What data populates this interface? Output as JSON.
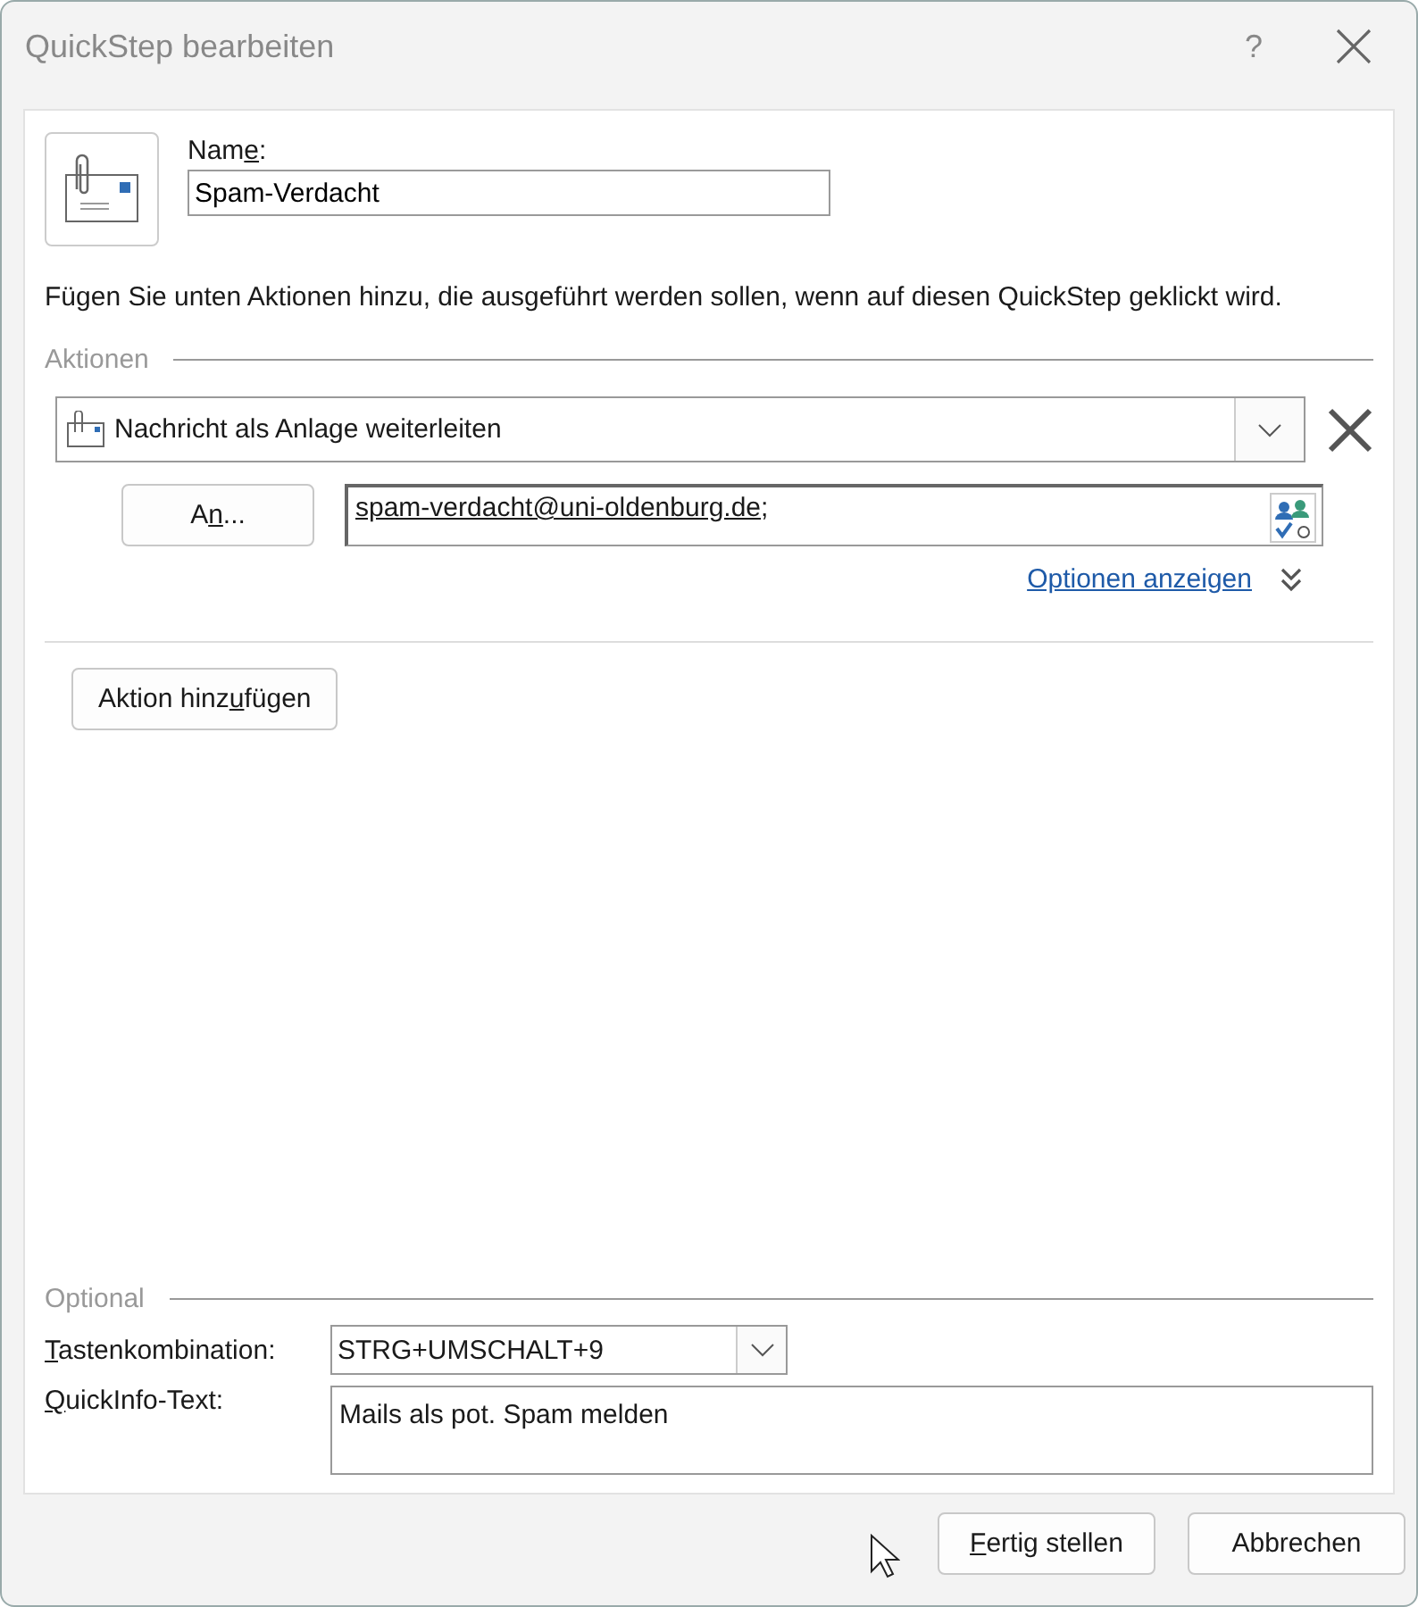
{
  "window": {
    "title": "QuickStep bearbeiten",
    "help": "?"
  },
  "name": {
    "label": {
      "before": "Nam",
      "key": "e",
      "after": ":"
    },
    "value": "Spam-Verdacht"
  },
  "description": "Fügen Sie unten Aktionen hinzu, die ausgeführt werden sollen, wenn auf diesen QuickStep geklickt wird.",
  "actions_section": {
    "title": "Aktionen",
    "actions": [
      {
        "kind": "forward",
        "label": "Nachricht als Anlage weiterleiten",
        "to_button": {
          "before": "A",
          "key": "n",
          "after": "..."
        },
        "recipients": [
          {
            "address": "spam-verdacht@uni-oldenburg.de",
            "resolved": true
          }
        ],
        "separator": ";",
        "options_link": "Optionen anzeigen"
      }
    ],
    "add_button": {
      "before": "Aktion hinz",
      "key": "u",
      "after": "fügen"
    }
  },
  "optional_section": {
    "title": "Optional",
    "shortcut": {
      "label": {
        "key": "T",
        "after": "astenkombination:"
      },
      "value": "STRG+UMSCHALT+9"
    },
    "tooltip": {
      "label": {
        "key": "Q",
        "after": "uickInfo-Text:"
      },
      "value": "Mails als pot. Spam melden"
    }
  },
  "buttons": [
    {
      "label": {
        "key": "F",
        "after": "ertig stellen"
      }
    },
    {
      "label": {
        "before": "Abbrechen"
      }
    }
  ]
}
